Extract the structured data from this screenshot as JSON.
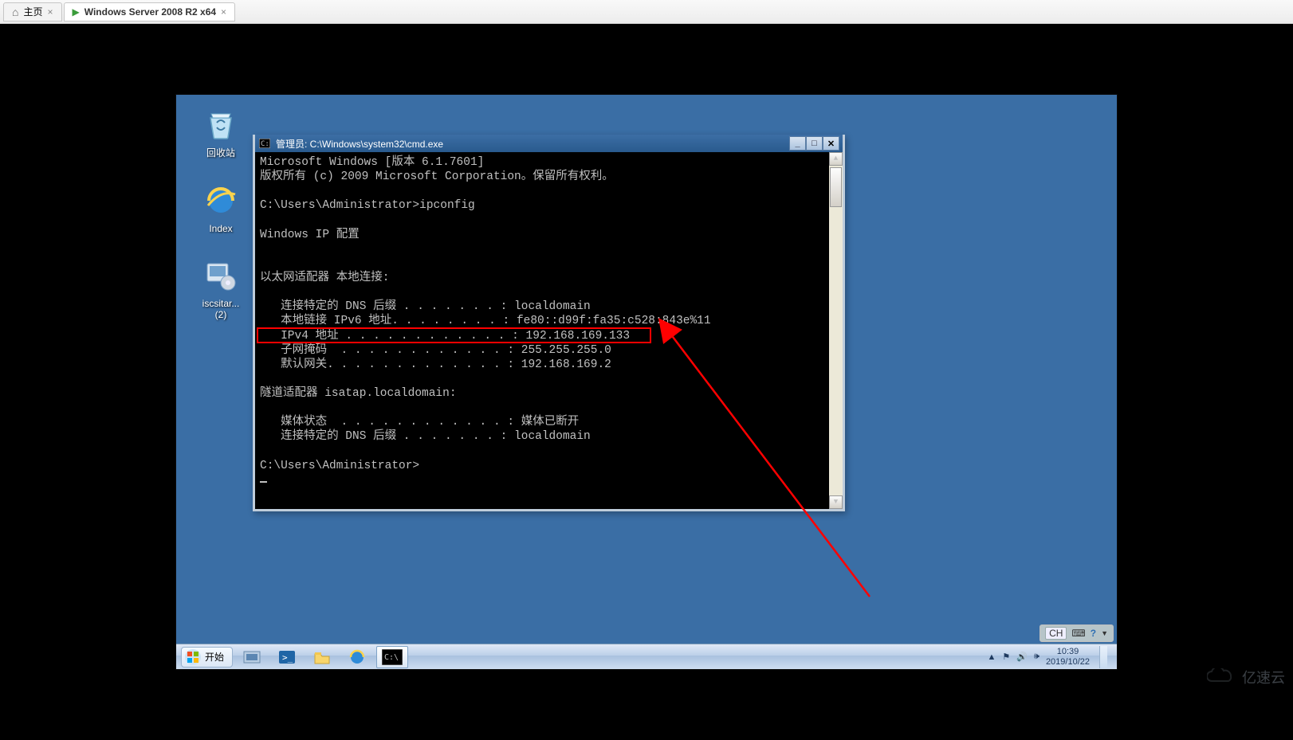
{
  "outer_tabs": {
    "home_icon": "⌂",
    "home_label": "主页",
    "vm_label": "Windows Server 2008 R2 x64"
  },
  "desktop": {
    "icons": [
      {
        "name": "回收站",
        "glyph": "recycle"
      },
      {
        "name": "Index",
        "glyph": "ie"
      },
      {
        "name": "iscsitar...\n(2)",
        "glyph": "drive"
      }
    ]
  },
  "cmd": {
    "title": "管理员: C:\\Windows\\system32\\cmd.exe",
    "lines": [
      "Microsoft Windows [版本 6.1.7601]",
      "版权所有 (c) 2009 Microsoft Corporation。保留所有权利。",
      "",
      "C:\\Users\\Administrator>ipconfig",
      "",
      "Windows IP 配置",
      "",
      "",
      "以太网适配器 本地连接:",
      "",
      "   连接特定的 DNS 后缀 . . . . . . . : localdomain",
      "   本地链接 IPv6 地址. . . . . . . . : fe80::d99f:fa35:c528:843e%11",
      "   IPv4 地址 . . . . . . . . . . . . : 192.168.169.133",
      "   子网掩码  . . . . . . . . . . . . : 255.255.255.0",
      "   默认网关. . . . . . . . . . . . . : 192.168.169.2",
      "",
      "隧道适配器 isatap.localdomain:",
      "",
      "   媒体状态  . . . . . . . . . . . . : 媒体已断开",
      "   连接特定的 DNS 后缀 . . . . . . . : localdomain",
      "",
      "C:\\Users\\Administrator>"
    ]
  },
  "traystrip": {
    "lang": "CH",
    "kb_icon": "⌨",
    "help_icon": "?"
  },
  "taskbar": {
    "start_label": "开始",
    "items": [
      "server-manager",
      "powershell",
      "explorer",
      "ie",
      "cmd"
    ],
    "tray_icons": [
      "▲",
      "⚑",
      "🔊",
      "🕪"
    ],
    "time": "10:39",
    "date": "2019/10/22"
  },
  "watermark": {
    "text": "亿速云"
  }
}
